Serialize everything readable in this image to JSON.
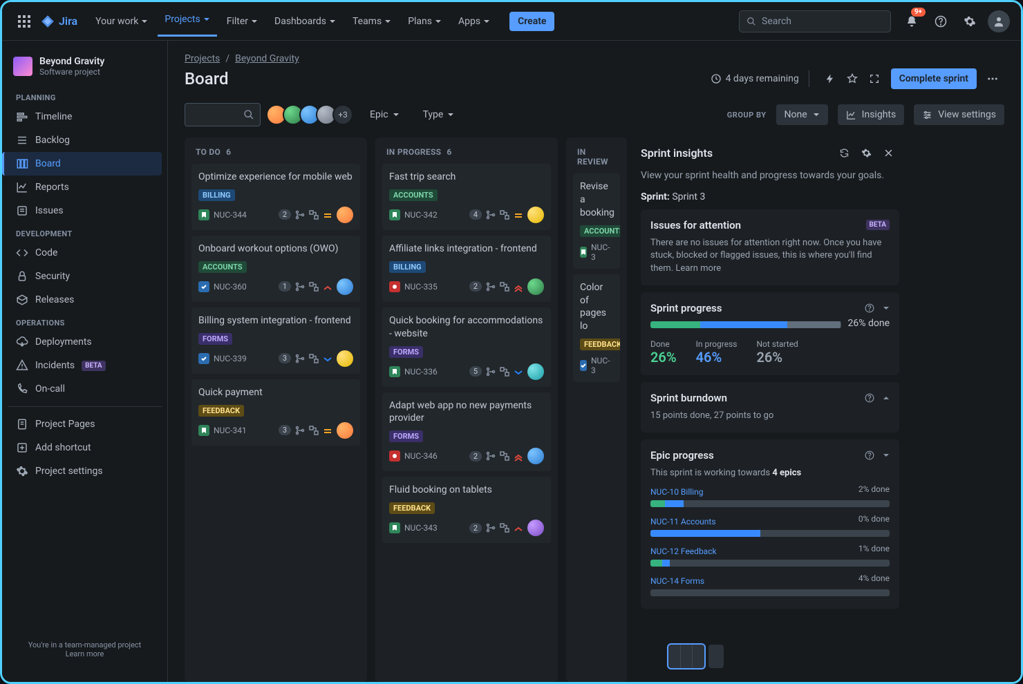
{
  "topnav": {
    "brand": "Jira",
    "items": [
      "Your work",
      "Projects",
      "Filter",
      "Dashboards",
      "Teams",
      "Plans",
      "Apps"
    ],
    "active_index": 1,
    "create": "Create",
    "search_placeholder": "Search",
    "notif_badge": "9+"
  },
  "sidebar": {
    "project_name": "Beyond Gravity",
    "project_type": "Software project",
    "sections": {
      "planning": {
        "label": "PLANNING",
        "items": [
          "Timeline",
          "Backlog",
          "Board",
          "Reports",
          "Issues"
        ],
        "active_index": 2
      },
      "development": {
        "label": "DEVELOPMENT",
        "items": [
          "Code",
          "Security",
          "Releases"
        ]
      },
      "operations": {
        "label": "OPERATIONS",
        "items": [
          "Deployments",
          "Incidents",
          "On-call"
        ],
        "incidents_beta": "BETA"
      }
    },
    "bottom_items": [
      "Project Pages",
      "Add shortcut",
      "Project settings"
    ],
    "footer_line1": "You're in a team-managed project",
    "footer_line2": "Learn more"
  },
  "header": {
    "breadcrumb": [
      "Projects",
      "Beyond Gravity"
    ],
    "title": "Board",
    "days_remaining": "4 days remaining",
    "complete_sprint": "Complete sprint"
  },
  "filters": {
    "avatars_plus": "+3",
    "epic_label": "Epic",
    "type_label": "Type",
    "group_by_label": "GROUP BY",
    "group_by_value": "None",
    "insights_btn": "Insights",
    "view_settings": "View settings"
  },
  "columns": [
    {
      "title": "TO DO",
      "count": 6,
      "cards": [
        {
          "title": "Optimize experience for mobile web",
          "tag": "BILLING",
          "type": "story",
          "key": "NUC-344",
          "badge": "2",
          "prio": "medium",
          "assignee": "orange"
        },
        {
          "title": "Onboard workout options (OWO)",
          "tag": "ACCOUNTS",
          "type": "task",
          "key": "NUC-360",
          "badge": "1",
          "prio": "high",
          "assignee": "blue"
        },
        {
          "title": "Billing system integration - frontend",
          "tag": "FORMS",
          "type": "task",
          "key": "NUC-339",
          "badge": "3",
          "prio": "low",
          "assignee": "yellow"
        },
        {
          "title": "Quick payment",
          "tag": "FEEDBACK",
          "type": "story",
          "key": "NUC-341",
          "badge": "3",
          "prio": "medium",
          "assignee": "orange"
        }
      ]
    },
    {
      "title": "IN PROGRESS",
      "count": 6,
      "cards": [
        {
          "title": "Fast trip search",
          "tag": "ACCOUNTS",
          "type": "story",
          "key": "NUC-342",
          "badge": "4",
          "prio": "medium",
          "assignee": "yellow"
        },
        {
          "title": "Affiliate links integration - frontend",
          "tag": "BILLING",
          "type": "bug",
          "key": "NUC-335",
          "badge": "2",
          "prio": "highest",
          "assignee": "green"
        },
        {
          "title": "Quick booking for accommodations - website",
          "tag": "FORMS",
          "type": "story",
          "key": "NUC-336",
          "badge": "5",
          "prio": "low",
          "assignee": "teal"
        },
        {
          "title": "Adapt web app no new payments provider",
          "tag": "FORMS",
          "type": "bug",
          "key": "NUC-346",
          "badge": "2",
          "prio": "highest",
          "assignee": "blue"
        },
        {
          "title": "Fluid booking on tablets",
          "tag": "FEEDBACK",
          "type": "story",
          "key": "NUC-343",
          "badge": "2",
          "prio": "high",
          "assignee": "purple"
        }
      ]
    },
    {
      "title": "IN REVIEW",
      "count": null,
      "cards": [
        {
          "title": "Revise a booking",
          "tag": "ACCOUNTS",
          "type": "story",
          "key": "NUC-3"
        },
        {
          "title": "Color of pages lo",
          "tag": "FEEDBACK",
          "type": "task",
          "key": "NUC-3"
        }
      ]
    }
  ],
  "insights": {
    "title": "Sprint insights",
    "subtitle": "View your sprint health and progress towards your goals.",
    "sprint_label": "Sprint:",
    "sprint_value": "Sprint 3",
    "attention": {
      "title": "Issues for attention",
      "badge": "BETA",
      "body": "There are no issues for attention right now. Once you have stuck, blocked or flagged issues, this is where you'll find them. Learn more"
    },
    "progress": {
      "title": "Sprint progress",
      "done_pct": 26,
      "inprog_pct": 46,
      "not_pct": 26,
      "done_label_pair": "26% done",
      "m_done_label": "Done",
      "m_done_val": "26%",
      "m_inprog_label": "In progress",
      "m_inprog_val": "46%",
      "m_not_label": "Not started",
      "m_not_val": "26%"
    },
    "burndown": {
      "title": "Sprint burndown",
      "body": "15 points done, 27 points to go"
    },
    "epic": {
      "title": "Epic progress",
      "body_prefix": "This sprint is working towards ",
      "body_bold": "4 epics",
      "rows": [
        {
          "name": "NUC-10 Billing",
          "done_label": "2% done",
          "d": 6,
          "p": 8
        },
        {
          "name": "NUC-11 Accounts",
          "done_label": "0% done",
          "d": 0,
          "p": 46
        },
        {
          "name": "NUC-12 Feedback",
          "done_label": "1% done",
          "d": 5,
          "p": 3
        },
        {
          "name": "NUC-14 Forms",
          "done_label": "4% done",
          "d": 0,
          "p": 0
        }
      ]
    }
  }
}
